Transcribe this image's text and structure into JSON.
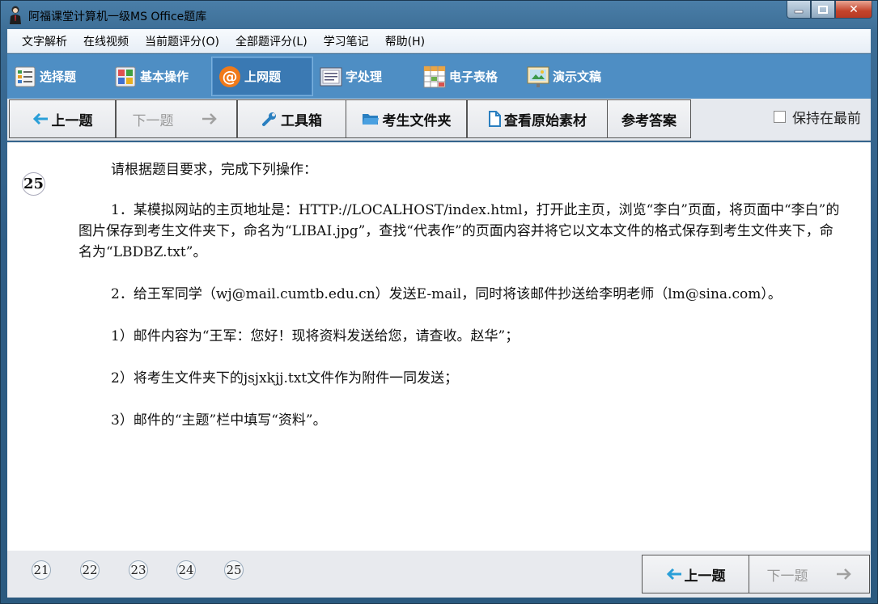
{
  "window": {
    "title": "阿福课堂计算机一级MS Office题库"
  },
  "menu": [
    "文字解析",
    "在线视频",
    "当前题评分(O)",
    "全部题评分(L)",
    "学习笔记",
    "帮助(H)"
  ],
  "categories": [
    {
      "label": "选择题",
      "icon": "list-icon"
    },
    {
      "label": "基本操作",
      "icon": "grid-icon"
    },
    {
      "label": "上网题",
      "icon": "at-icon",
      "active": true
    },
    {
      "label": "字处理",
      "icon": "document-icon"
    },
    {
      "label": "电子表格",
      "icon": "spreadsheet-icon"
    },
    {
      "label": "演示文稿",
      "icon": "presentation-icon"
    }
  ],
  "toolbar": {
    "prev": "上一题",
    "next": "下一题",
    "toolbox": "工具箱",
    "folder": "考生文件夹",
    "view_source": "查看原始素材",
    "answer": "参考答案",
    "keep_on_top": "保持在最前"
  },
  "question": {
    "number": "25",
    "paragraphs": [
      "请根据题目要求，完成下列操作：",
      "1．某模拟网站的主页地址是：HTTP://LOCALHOST/index.html，打开此主页，浏览“李白”页面，将页面中“李白”的图片保存到考生文件夹下，命名为“LIBAI.jpg”，查找“代表作”的页面内容并将它以文本文件的格式保存到考生文件夹下，命名为“LBDBZ.txt”。",
      "2．给王军同学（wj@mail.cumtb.edu.cn）发送E-mail，同时将该邮件抄送给李明老师（lm@sina.com）。",
      "1）邮件内容为“王军：您好！现将资料发送给您，请查收。赵华”；",
      "2）将考生文件夹下的jsjxkjj.txt文件作为附件一同发送；",
      "3）邮件的“主题”栏中填写“资料”。"
    ]
  },
  "pagination": {
    "pages": [
      "21",
      "22",
      "23",
      "24",
      "25"
    ],
    "prev": "上一题",
    "next": "下一题"
  },
  "colors": {
    "accent": "#4e8ec4",
    "arrow": "#2a9fd8"
  }
}
